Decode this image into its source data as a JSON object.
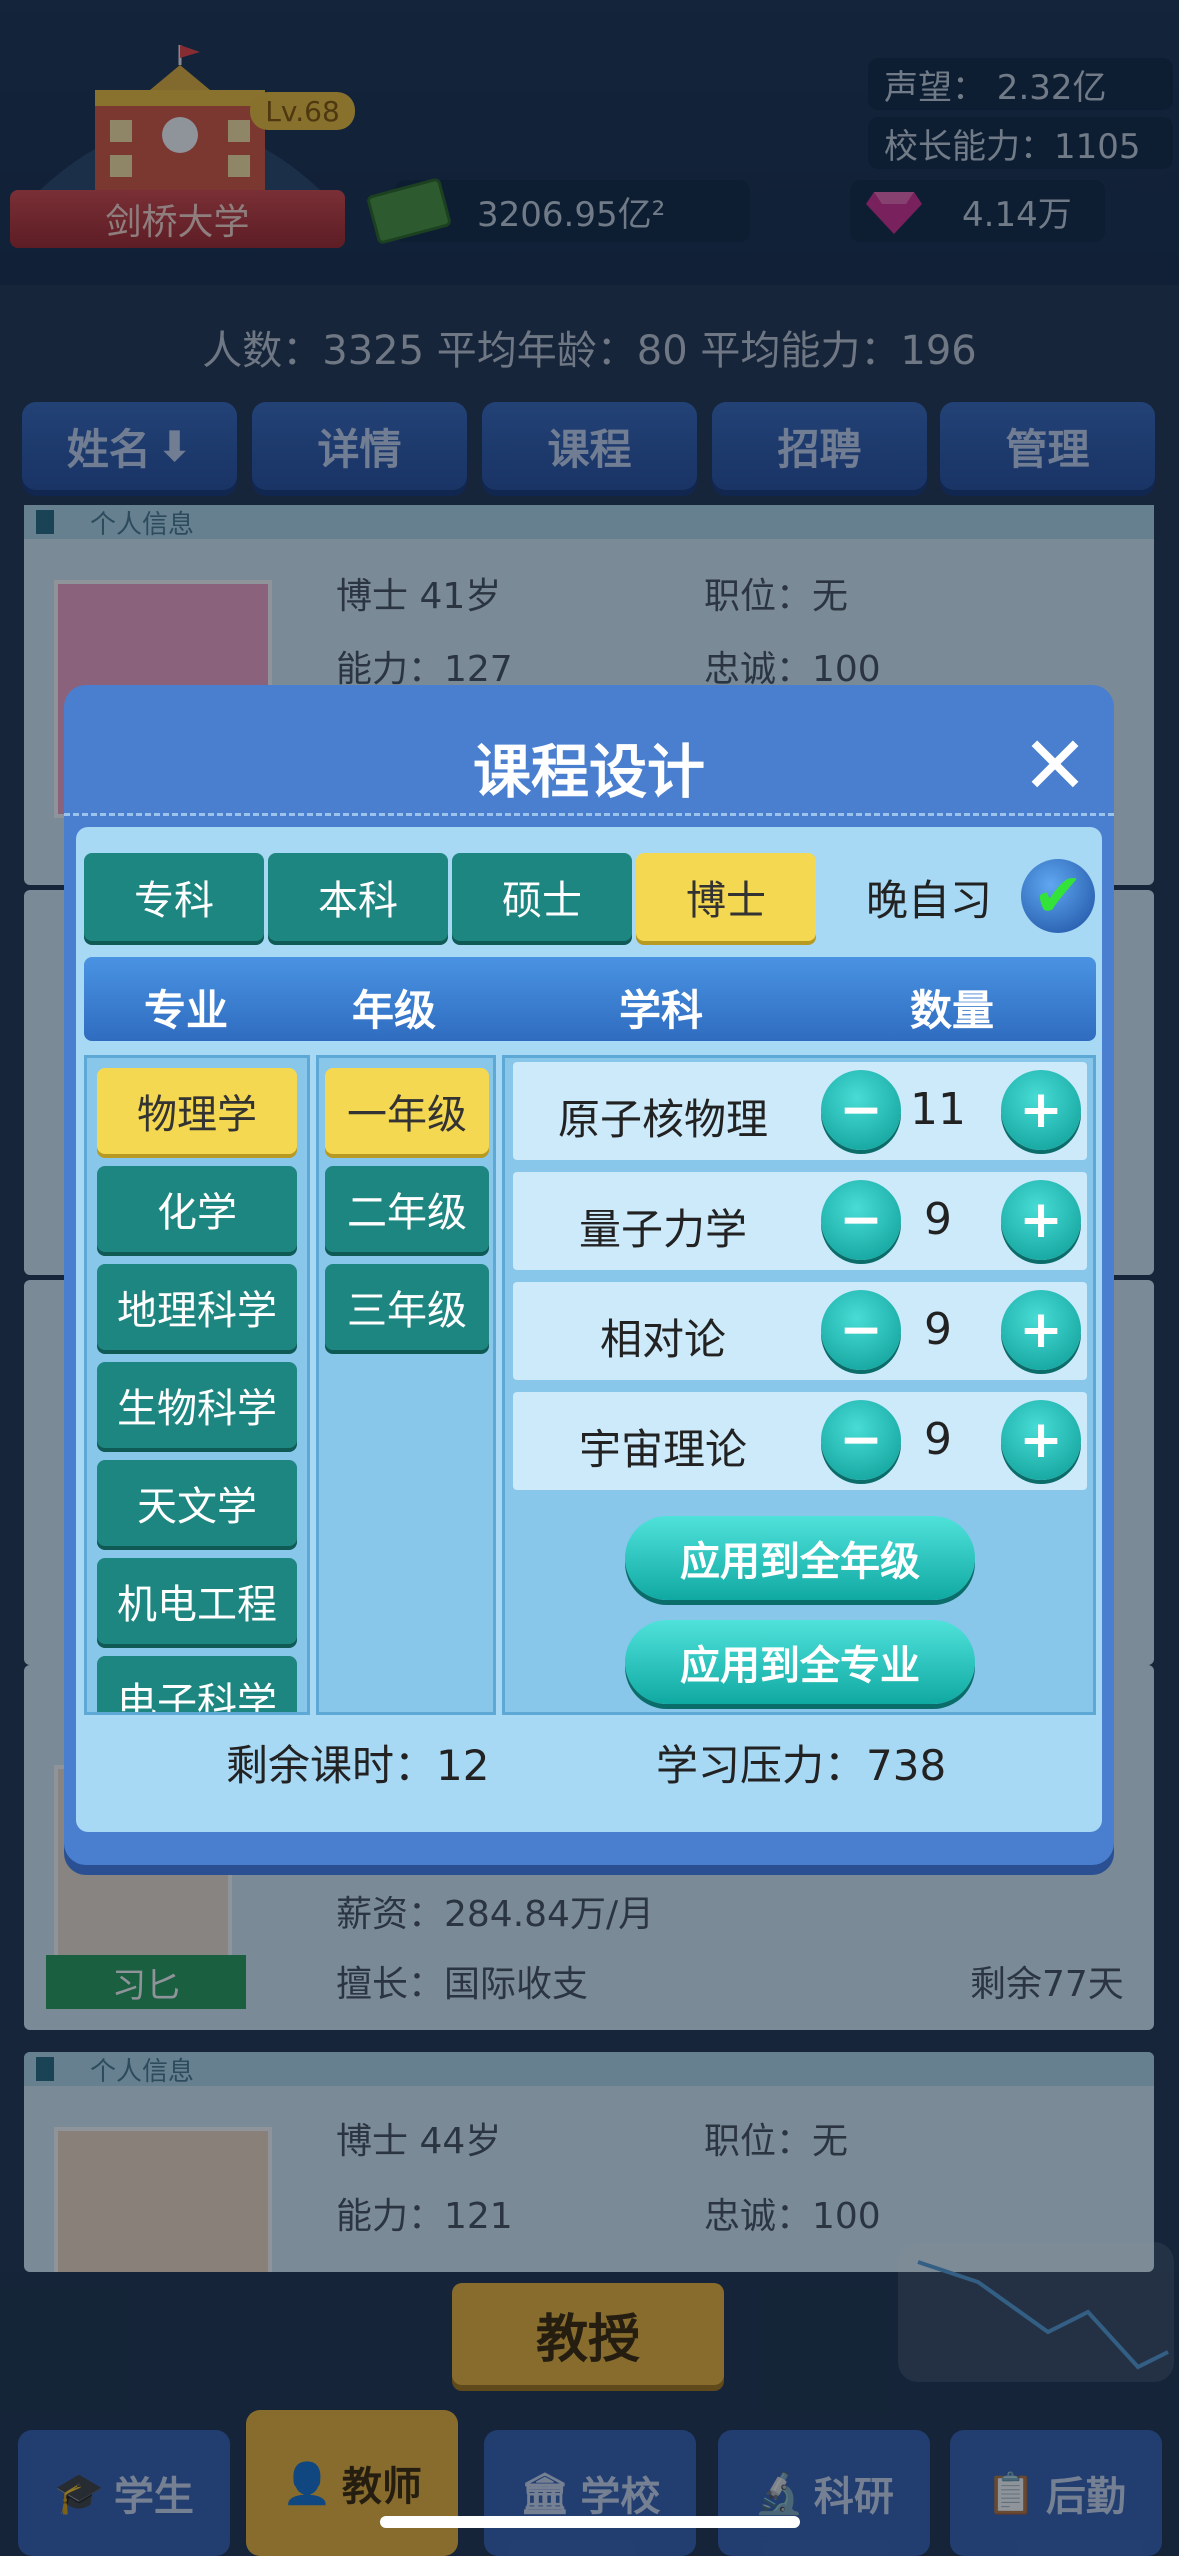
{
  "top": {
    "school_name": "剑桥大学",
    "level": "Lv.68",
    "money": "3206.95亿²",
    "prestige": "声望：  2.32亿",
    "principal_ability": "校长能力：1105",
    "gems": "4.14万"
  },
  "summary": "人数：3325  平均年龄：80  平均能力：196",
  "header_tabs": [
    "姓名",
    "详情",
    "课程",
    "招聘",
    "管理"
  ],
  "cards": {
    "header_label": "个人信息",
    "card1": {
      "l1": "博士    41岁",
      "l1r": "职位：无",
      "l2": "能力：127",
      "l2r": "忠诚：100"
    },
    "card3": {
      "salary": "薪资：284.84万/月",
      "specialty": "擅长：国际收支",
      "remaining": "剩余77天",
      "name": "习匕"
    },
    "card4": {
      "l1": "博士    44岁",
      "l1r": "职位：无",
      "l2": "能力：121",
      "l2r": "忠诚：100"
    }
  },
  "modal": {
    "title": "课程设计",
    "degree_tabs": [
      "专科",
      "本科",
      "硕士",
      "博士"
    ],
    "active_degree": "博士",
    "evening_study": "晚自习",
    "columns": [
      "专业",
      "年级",
      "学科",
      "数量"
    ],
    "majors": [
      "物理学",
      "化学",
      "地理科学",
      "生物科学",
      "天文学",
      "机电工程",
      "电子科学"
    ],
    "grades": [
      "一年级",
      "二年级",
      "三年级"
    ],
    "subjects": [
      {
        "name": "原子核物理",
        "count": "11"
      },
      {
        "name": "量子力学",
        "count": "9"
      },
      {
        "name": "相对论",
        "count": "9"
      },
      {
        "name": "宇宙理论",
        "count": "9"
      }
    ],
    "apply_grade": "应用到全年级",
    "apply_major": "应用到全专业",
    "remaining_hours": "剩余课时：12",
    "study_pressure": "学习压力：738"
  },
  "professor_button": "教授",
  "nav": [
    "学生",
    "教师",
    "学校",
    "科研",
    "后勤"
  ]
}
